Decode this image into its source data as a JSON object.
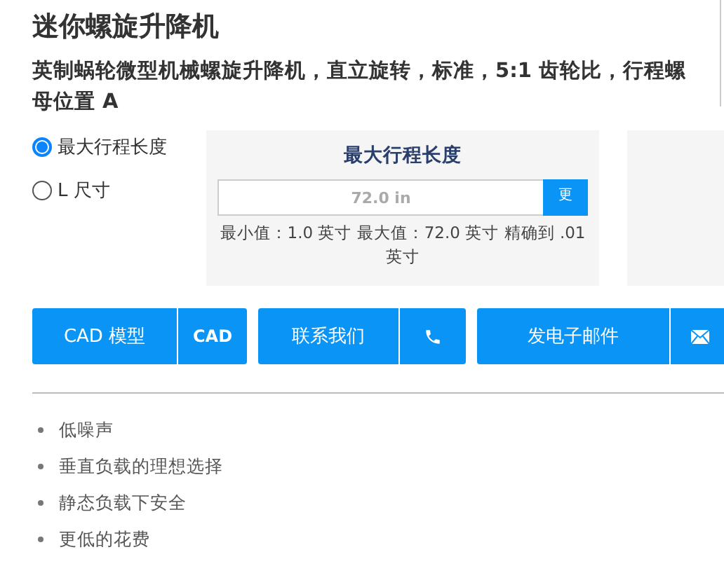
{
  "title": "迷你螺旋升降机",
  "subtitle": "英制蜗轮微型机械螺旋升降机，直立旋转，标准，5:1 齿轮比，行程螺母位置 A",
  "options": [
    {
      "label": "最大行程长度",
      "selected": true
    },
    {
      "label": "L 尺寸",
      "selected": false
    }
  ],
  "panel": {
    "heading": "最大行程长度",
    "placeholder": "72.0 in",
    "button": "更",
    "hint": "最小值：1.0 英寸 最大值：72.0 英寸 精确到 .01 英寸"
  },
  "actions": [
    {
      "label": "CAD 模型",
      "kind": "text",
      "side": "CAD"
    },
    {
      "label": "联系我们",
      "kind": "phone"
    },
    {
      "label": "发电子邮件",
      "kind": "mail"
    }
  ],
  "features": [
    "低噪声",
    "垂直负载的理想选择",
    "静态负载下安全",
    "更低的花费"
  ]
}
